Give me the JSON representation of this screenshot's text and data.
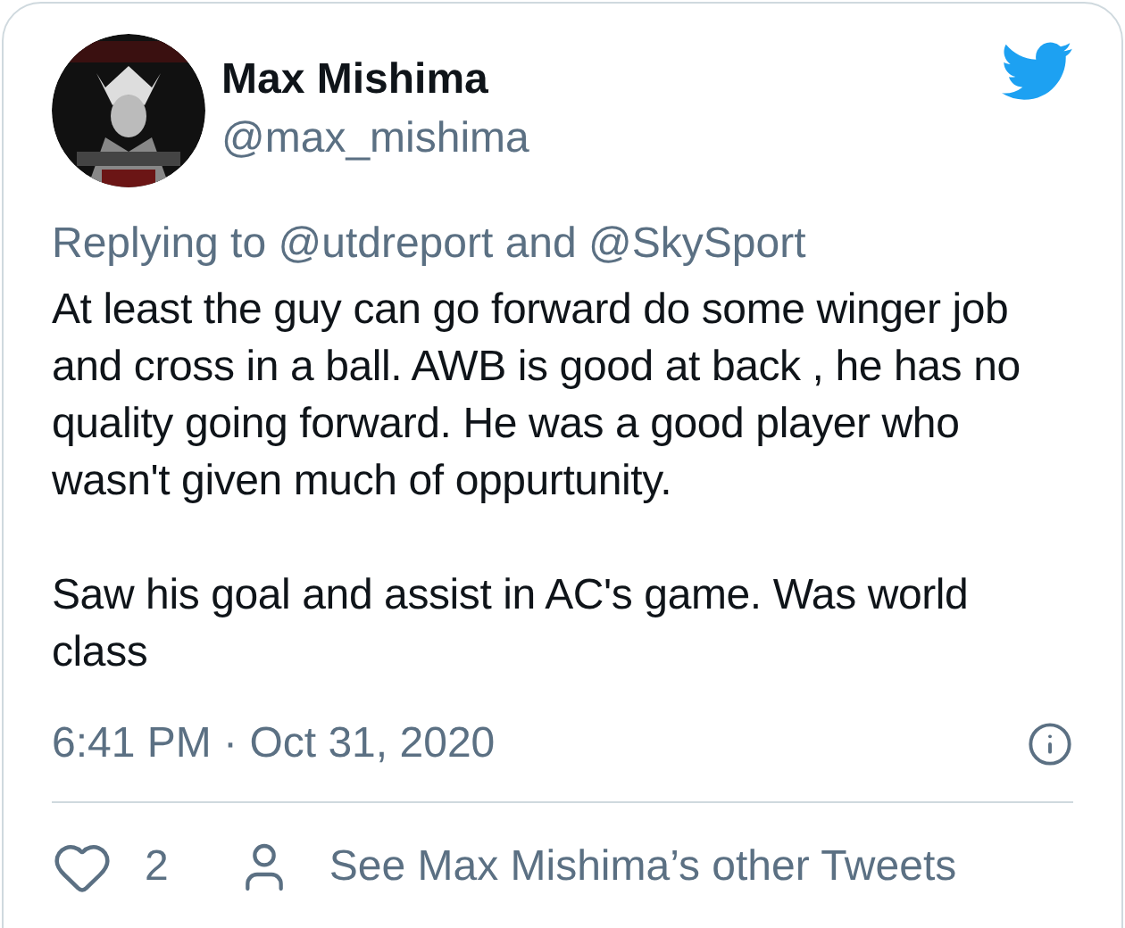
{
  "author": {
    "name": "Max Mishima",
    "handle": "@max_mishima"
  },
  "reply_context": "Replying to @utdreport and @SkySport",
  "body": [
    "At least the guy can go forward do some winger job and cross in a ball. AWB is good at back , he has no quality going forward. He was a good player who wasn't given much of oppurtunity.",
    "Saw his goal and assist in AC's game. Was world class"
  ],
  "timestamp": "6:41 PM · Oct 31, 2020",
  "actions": {
    "like_count": "2",
    "profile_link": "See Max Mishima’s other Tweets"
  }
}
